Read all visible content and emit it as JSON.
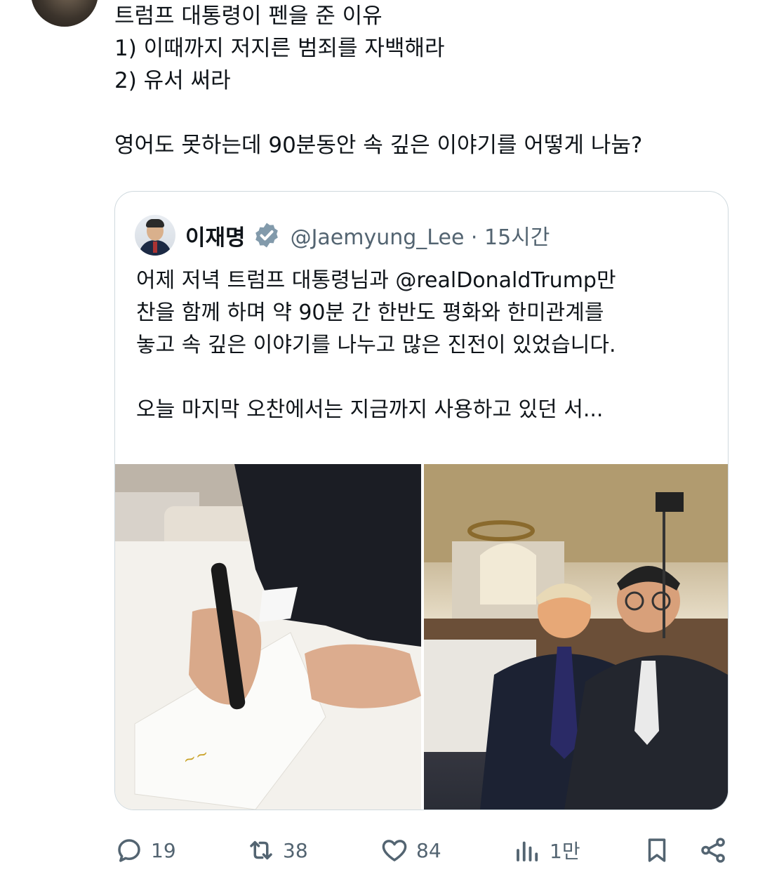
{
  "tweet": {
    "lines": [
      "트럼프 대통령이 펜을 준 이유",
      "1) 이때까지 저지른 범죄를 자백해라",
      "2) 유서 써라",
      "",
      "영어도 못하는데 90분동안 속 깊은 이야기를 어떻게 나눔?"
    ]
  },
  "quote": {
    "name": "이재명",
    "handle": "@Jaemyung_Lee · 15시간",
    "lines": [
      "어제 저녁 트럼프 대통령님과 @realDonaldTrump만",
      "찬을 함께 하며 약 90분 간 한반도 평화와 한미관계를",
      "놓고 속 깊은 이야기를 나누고 많은 진전이 있었습니다.",
      "",
      "오늘 마지막 오찬에서는 지금까지 사용하고 있던 서..."
    ]
  },
  "actions": {
    "replies": "19",
    "reposts": "38",
    "likes": "84",
    "views": "1만"
  },
  "colors": {
    "text": "#0f1419",
    "secondary": "#536471",
    "verified": "#829aab",
    "border": "#cfd9de"
  },
  "icons": [
    "reply-icon",
    "repost-icon",
    "like-icon",
    "views-icon",
    "bookmark-icon",
    "share-icon"
  ]
}
